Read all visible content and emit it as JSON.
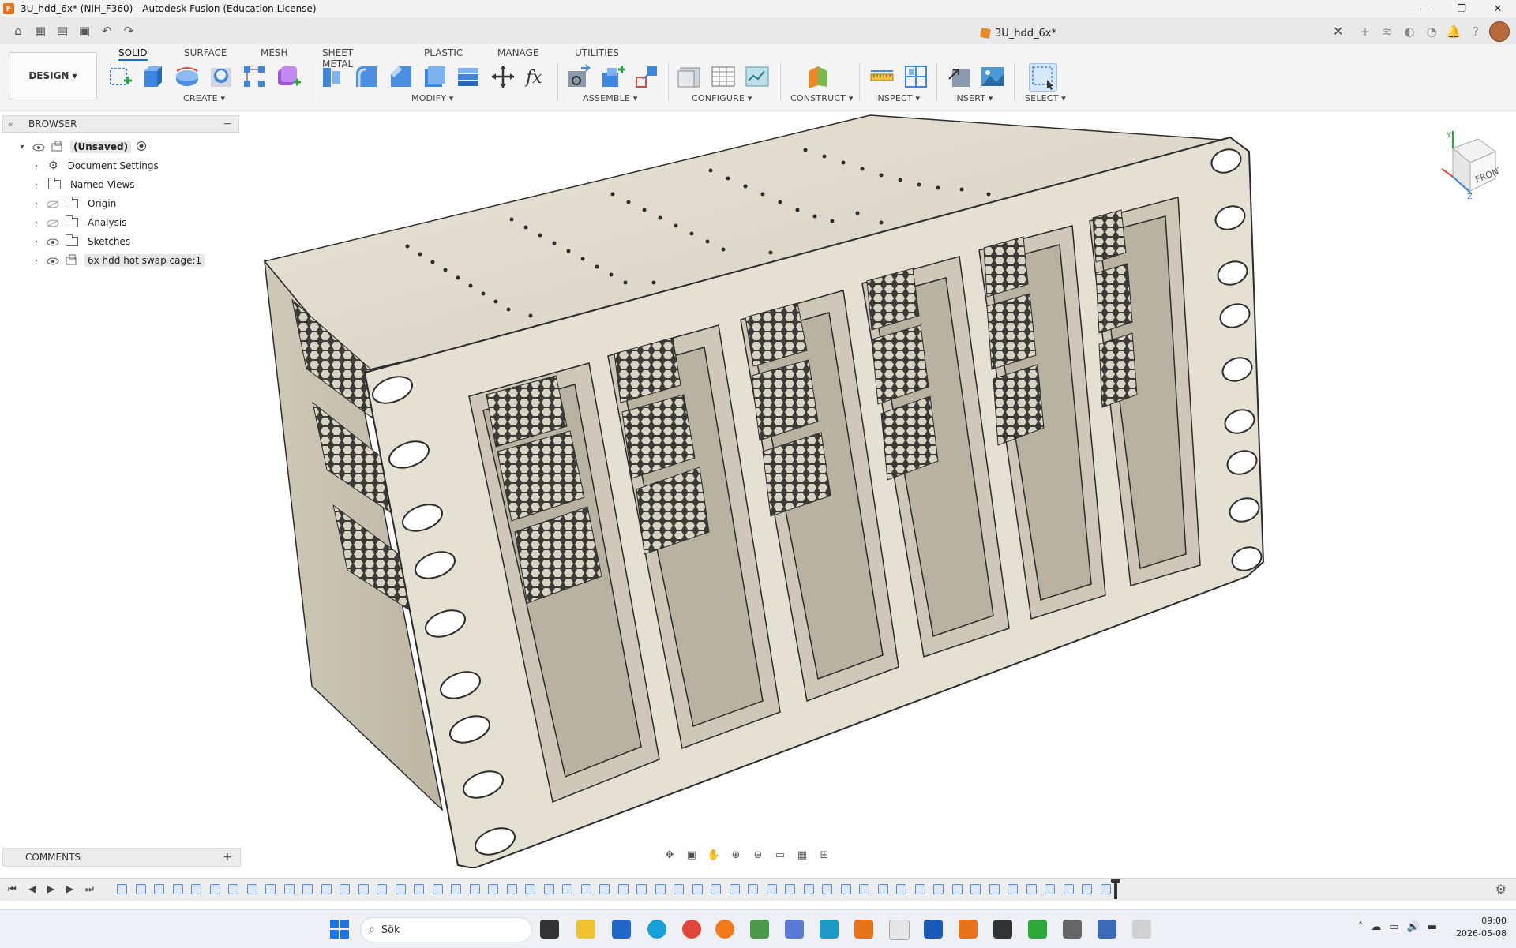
{
  "window": {
    "title": "3U_hdd_6x* (NiH_F360) - Autodesk Fusion (Education License)",
    "controls": [
      "—",
      "❐",
      "✕"
    ]
  },
  "quick_access": {
    "doc_tab_label": "3U_hdd_6x*",
    "close_tab": "✕"
  },
  "toolbar": {
    "design_button": "DESIGN ▾",
    "tabs": [
      "SOLID",
      "SURFACE",
      "MESH",
      "SHEET METAL",
      "PLASTIC",
      "MANAGE",
      "UTILITIES"
    ],
    "active_tab": "SOLID",
    "groups": {
      "create": "CREATE ▾",
      "modify": "MODIFY ▾",
      "assemble": "ASSEMBLE ▾",
      "configure": "CONFIGURE ▾",
      "construct": "CONSTRUCT ▾",
      "inspect": "INSPECT ▾",
      "insert": "INSERT ▾",
      "select": "SELECT ▾"
    }
  },
  "browser": {
    "title": "BROWSER",
    "items": [
      {
        "label": "(Unsaved)",
        "icon": "component-icon"
      },
      {
        "label": "Document Settings",
        "icon": "gear-icon"
      },
      {
        "label": "Named Views",
        "icon": "folder-icon"
      },
      {
        "label": "Origin",
        "icon": "folder-icon"
      },
      {
        "label": "Analysis",
        "icon": "folder-icon"
      },
      {
        "label": "Sketches",
        "icon": "folder-icon"
      },
      {
        "label": "6x hdd hot swap cage:1",
        "icon": "body-icon"
      }
    ]
  },
  "comments": {
    "title": "COMMENTS",
    "add": "+"
  },
  "viewcube": {
    "face_label": "FRONT",
    "axis_y": "Y",
    "axis_z": "Z"
  },
  "taskbar": {
    "search_placeholder": "Sök",
    "clock_time": "09:00",
    "clock_date": "2026-05-08"
  },
  "colors": {
    "model_body": "#e4e0d2",
    "model_edge": "#2c2c2c",
    "accent": "#1a6ed8"
  }
}
